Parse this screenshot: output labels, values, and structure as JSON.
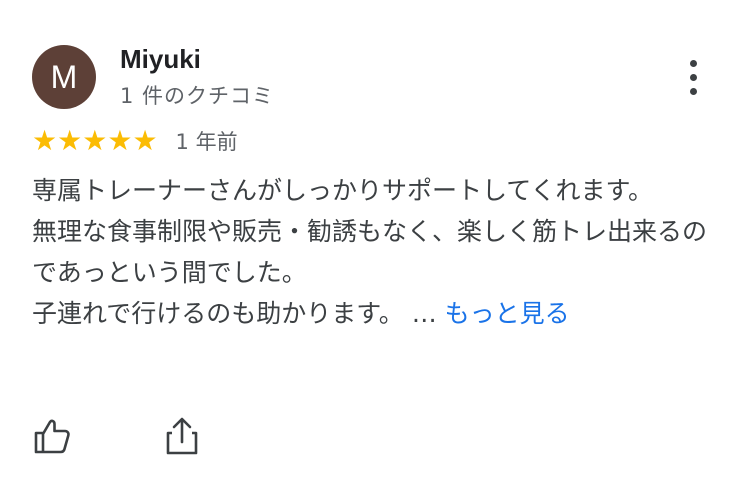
{
  "review": {
    "avatar_initial": "M",
    "avatar_color": "#5d4037",
    "author": "Miyuki",
    "author_review_count": "1 件のクチコミ",
    "rating_stars": 5,
    "star_glyph": "★",
    "star_color": "#fbbc04",
    "time_ago": "1 年前",
    "paragraphs": [
      "専属トレーナーさんがしっかりサポートしてくれます。",
      "無理な食事制限や販売・勧誘もなく、楽しく筋トレ出来るのであっという間でした。"
    ],
    "last_line": "子連れで行けるのも助かります。",
    "ellipsis": " … ",
    "more_label": "もっと見る",
    "link_color": "#1a73e8"
  },
  "icons": {
    "menu": "more-vert-icon",
    "like": "thumb-up-icon",
    "share": "share-icon"
  }
}
